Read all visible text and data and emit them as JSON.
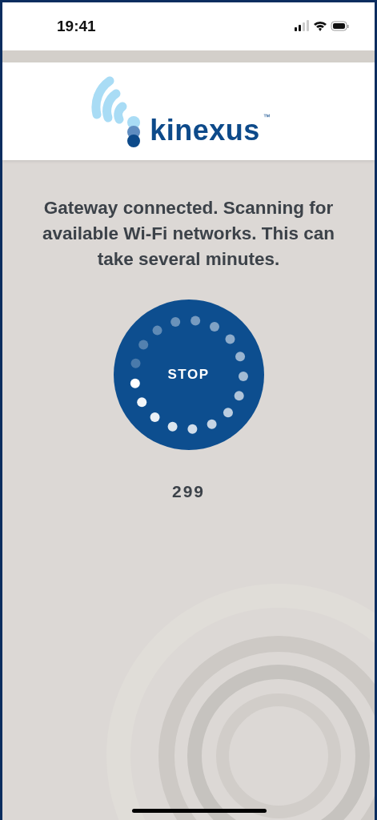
{
  "status_bar": {
    "time": "19:41"
  },
  "logo": {
    "text": "kinexus",
    "trademark": "™"
  },
  "message": "Gateway connected. Scanning for available Wi-Fi networks. This can take several minutes.",
  "stop_button": {
    "label": "STOP"
  },
  "countdown": "299"
}
